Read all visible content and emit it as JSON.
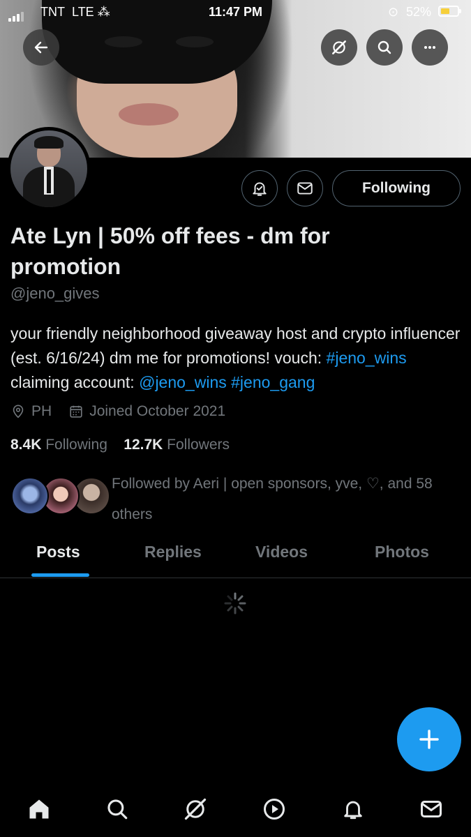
{
  "status_bar": {
    "carrier": "TNT",
    "network": "LTE",
    "time": "11:47 PM",
    "battery_percent": "52%",
    "battery_level": 0.52
  },
  "header": {
    "back_icon": "back-arrow-icon",
    "grok_icon": "grok-icon",
    "search_icon": "search-icon",
    "more_icon": "more-icon"
  },
  "profile": {
    "display_name": "Ate Lyn | 50% off fees - dm for promotion",
    "handle": "@jeno_gives",
    "bio": {
      "text1": "your friendly neighborhood giveaway host and crypto influencer (est. 6/16/24) dm me for promotions! vouch: ",
      "link1": "#jeno_wins",
      "text2": " claiming account: ",
      "link2": "@jeno_wins",
      "text3": " ",
      "link3": "#jeno_gang"
    },
    "location": "PH",
    "joined": "Joined October 2021",
    "following_count": "8.4K",
    "following_label": "Following",
    "followers_count": "12.7K",
    "followers_label": "Followers",
    "followed_by": "Followed by Aeri | open sponsors, yve, ♡, and 58 others"
  },
  "actions": {
    "notify_icon": "bell-icon",
    "message_icon": "mail-icon",
    "following_button": "Following"
  },
  "tabs": [
    {
      "label": "Posts",
      "active": true
    },
    {
      "label": "Replies",
      "active": false
    },
    {
      "label": "Videos",
      "active": false
    },
    {
      "label": "Photos",
      "active": false
    }
  ],
  "fab": {
    "icon": "plus-icon"
  },
  "bottom_nav": [
    "home-icon",
    "search-icon",
    "grok-icon",
    "video-icon",
    "bell-icon",
    "mail-icon"
  ],
  "colors": {
    "accent": "#1d9bf0",
    "background": "#000000",
    "muted": "#71767b"
  }
}
